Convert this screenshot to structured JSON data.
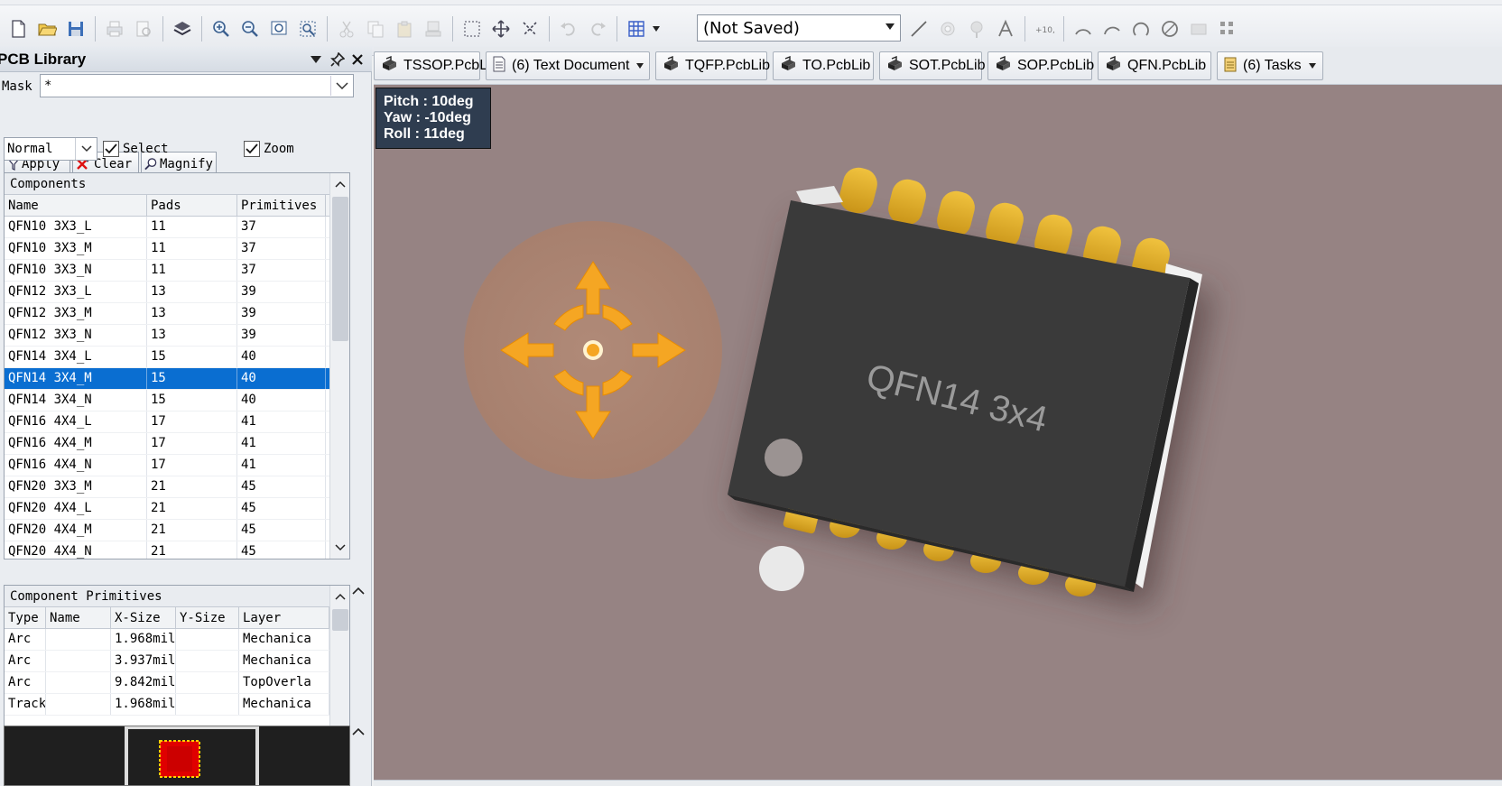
{
  "toolbar": {
    "history_combo": "(Not Saved)",
    "icons_left": [
      "new-file-icon",
      "open-folder-icon",
      "save-icon",
      "print-icon",
      "print-preview-icon",
      "layers-icon",
      "zoom-in-icon",
      "zoom-out-icon",
      "zoom-fit-icon",
      "zoom-selection-icon",
      "cut-icon",
      "copy-icon",
      "paste-icon",
      "rubber-stamp-icon",
      "select-area-icon",
      "move-icon",
      "cross-select-icon",
      "undo-icon",
      "redo-icon",
      "grid-icon"
    ],
    "icons_right": [
      "line-icon",
      "pad-icon",
      "via-icon",
      "text-icon",
      "coordinate-icon",
      "arc-edge-icon",
      "arc-center-icon",
      "arc-any-icon",
      "full-circle-icon",
      "fill-icon",
      "array-icon"
    ]
  },
  "panel": {
    "title": "PCB Library",
    "mask_label": "Mask",
    "mask_value": "*",
    "apply_label": "Apply",
    "clear_label": "Clear",
    "magnify_label": "Magnify",
    "mode_value": "Normal",
    "select_label": "Select",
    "zoom_label": "Zoom",
    "components": {
      "title": "Components",
      "headers": [
        "Name",
        "Pads",
        "Primitives"
      ],
      "rows": [
        [
          "QFN10 3X3_L",
          "11",
          "37"
        ],
        [
          "QFN10 3X3_M",
          "11",
          "37"
        ],
        [
          "QFN10 3X3_N",
          "11",
          "37"
        ],
        [
          "QFN12 3X3_L",
          "13",
          "39"
        ],
        [
          "QFN12 3X3_M",
          "13",
          "39"
        ],
        [
          "QFN12 3X3_N",
          "13",
          "39"
        ],
        [
          "QFN14 3X4_L",
          "15",
          "40"
        ],
        [
          "QFN14 3X4_M",
          "15",
          "40"
        ],
        [
          "QFN14 3X4_N",
          "15",
          "40"
        ],
        [
          "QFN16 4X4_L",
          "17",
          "41"
        ],
        [
          "QFN16 4X4_M",
          "17",
          "41"
        ],
        [
          "QFN16 4X4_N",
          "17",
          "41"
        ],
        [
          "QFN20 3X3_M",
          "21",
          "45"
        ],
        [
          "QFN20 4X4_L",
          "21",
          "45"
        ],
        [
          "QFN20 4X4_M",
          "21",
          "45"
        ],
        [
          "QFN20 4X4_N",
          "21",
          "45"
        ]
      ],
      "selected_index": 7
    },
    "primitives": {
      "title": "Component Primitives",
      "headers": [
        "Type",
        "Name",
        "X-Size",
        "Y-Size",
        "Layer"
      ],
      "rows": [
        [
          "Arc",
          "",
          "1.968mil",
          "",
          "Mechanica"
        ],
        [
          "Arc",
          "",
          "3.937mil",
          "",
          "Mechanica"
        ],
        [
          "Arc",
          "",
          "9.842mil",
          "",
          "TopOverla"
        ],
        [
          "Track",
          "",
          "1.968mil",
          "",
          "Mechanica"
        ]
      ]
    }
  },
  "tabs": [
    {
      "label": "TSSOP.PcbLib",
      "icon": "pcb-library-icon",
      "dropdown": false
    },
    {
      "label": "(6) Text Document",
      "icon": "text-document-icon",
      "dropdown": true
    },
    {
      "label": "TQFP.PcbLib",
      "icon": "pcb-library-icon",
      "dropdown": false
    },
    {
      "label": "TO.PcbLib",
      "icon": "pcb-library-icon",
      "dropdown": false
    },
    {
      "label": "SOT.PcbLib",
      "icon": "pcb-library-icon",
      "dropdown": false
    },
    {
      "label": "SOP.PcbLib",
      "icon": "pcb-library-icon",
      "dropdown": false
    },
    {
      "label": "QFN.PcbLib",
      "icon": "pcb-library-icon",
      "dropdown": false
    },
    {
      "label": "(6) Tasks",
      "icon": "tasks-icon",
      "dropdown": true
    }
  ],
  "view3d": {
    "pitch": "Pitch : 10deg",
    "yaw": "Yaw : -10deg",
    "roll": "Roll : 11deg",
    "component_label": "QFN14 3x4",
    "background_color": "#968383",
    "body_color": "#3a3a3a",
    "pad_color": "#e3b32c",
    "gizmo_color": "#f5a623"
  }
}
